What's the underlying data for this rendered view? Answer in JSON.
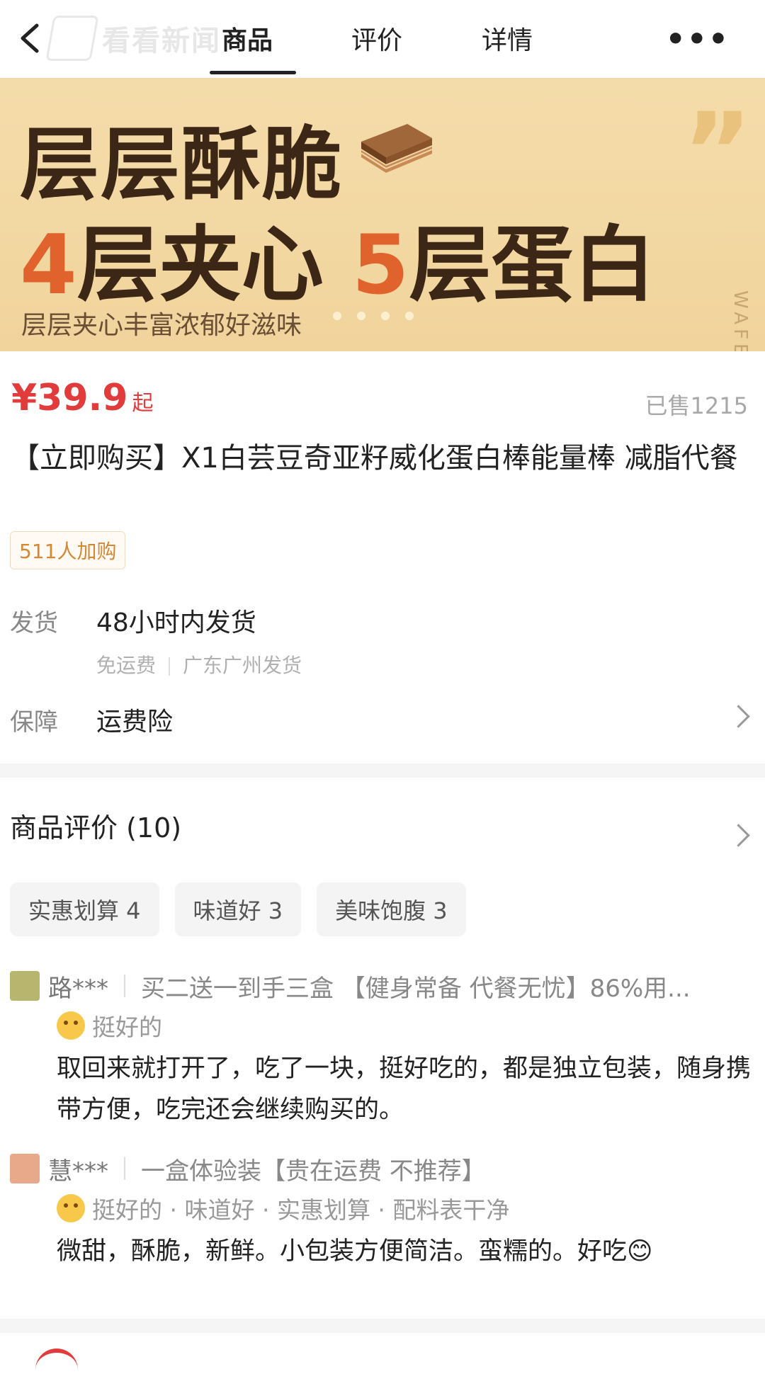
{
  "header": {
    "watermark": "看看新闻",
    "tabs": [
      {
        "label": "商品",
        "active": true
      },
      {
        "label": "评价",
        "active": false
      },
      {
        "label": "详情",
        "active": false
      }
    ],
    "more": "•••"
  },
  "banner": {
    "line1": "层层酥脆",
    "line2_num1": "4",
    "line2_text1": "层夹心",
    "line2_num2": "5",
    "line2_text2": "层蛋白",
    "subtitle": "层层夹心丰富浓郁好滋味",
    "quote": "”",
    "side_text": "WAFER",
    "accent_color": "#e0632d"
  },
  "product": {
    "price": "¥39.9",
    "price_suffix": "起",
    "sold": "已售1215",
    "title": "【立即购买】X1白芸豆奇亚籽威化蛋白棒能量棒 减脂代餐",
    "cart_badge": "511人加购",
    "shipping_label": "发货",
    "shipping_value": "48小时内发货",
    "shipping_fee": "免运费",
    "shipping_from": "广东广州发货",
    "guarantee_label": "保障",
    "guarantee_value": "运费险",
    "price_color": "#e23b3b"
  },
  "reviews": {
    "header": "商品评价 (10)",
    "tags": [
      "实惠划算 4",
      "味道好 3",
      "美味饱腹 3"
    ],
    "items": [
      {
        "user": "路***",
        "spec": "买二送一到手三盒 【健身常备 代餐无忧】86%用...",
        "rating": "挺好的",
        "text": "取回来就打开了，吃了一块，挺好吃的，都是独立包装，随身携带方便，吃完还会继续购买的。",
        "avatar_color": "#b7b56e"
      },
      {
        "user": "慧***",
        "spec": "一盒体验装【贵在运费 不推荐】",
        "rating": "挺好的 · 味道好 · 实惠划算 · 配料表干净",
        "text": "微甜，酥脆，新鲜。小包装方便简洁。蛮糯的。好吃😊",
        "avatar_color": "#e8a98a"
      }
    ]
  }
}
